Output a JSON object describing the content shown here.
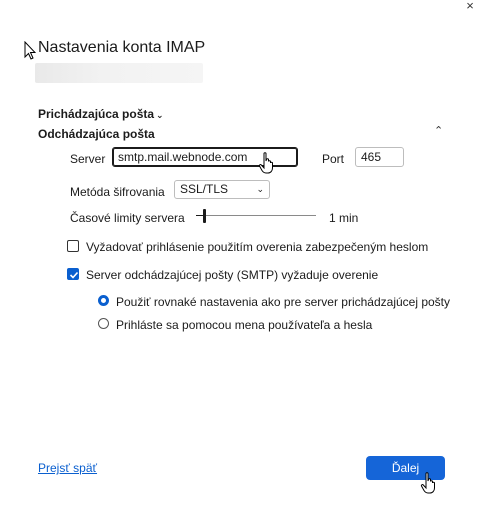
{
  "dialog": {
    "title": "Nastavenia konta IMAP",
    "close_glyph": "×"
  },
  "sections": {
    "incoming": "Prichádzajúca pošta",
    "outgoing": "Odchádzajúca pošta"
  },
  "outgoing": {
    "server_label": "Server",
    "server_value": "smtp.mail.webnode.com",
    "port_label": "Port",
    "port_value": "465",
    "encryption_label": "Metóda šifrovania",
    "encryption_value": "SSL/TLS",
    "timeout_label": "Časové limity servera",
    "timeout_value": "1 min",
    "timeout_fraction": 0.07,
    "spa_label": "Vyžadovať prihlásenie použitím overenia zabezpečeným heslom",
    "spa_checked": false,
    "smtp_auth_label": "Server odchádzajúcej pošty (SMTP) vyžaduje overenie",
    "smtp_auth_checked": true,
    "auth_options": [
      {
        "label": "Použiť rovnaké nastavenia ako pre server prichádzajúcej pošty",
        "selected": true
      },
      {
        "label": "Prihláste sa pomocou mena používateľa a hesla",
        "selected": false
      }
    ]
  },
  "footer": {
    "back_label": "Prejsť späť",
    "next_label": "Ďalej"
  },
  "colors": {
    "accent": "#1565d8",
    "checkbox": "#0a5fcf"
  },
  "icons": {
    "close": "close-icon",
    "incoming_chevron": "chevron-down-icon",
    "outgoing_chevron": "chevron-up-icon",
    "select_chevron": "chevron-down-icon",
    "checkmark": "checkmark-icon",
    "cursor_pointer": "arrow-cursor-icon",
    "cursor_hand": "hand-cursor-icon"
  }
}
